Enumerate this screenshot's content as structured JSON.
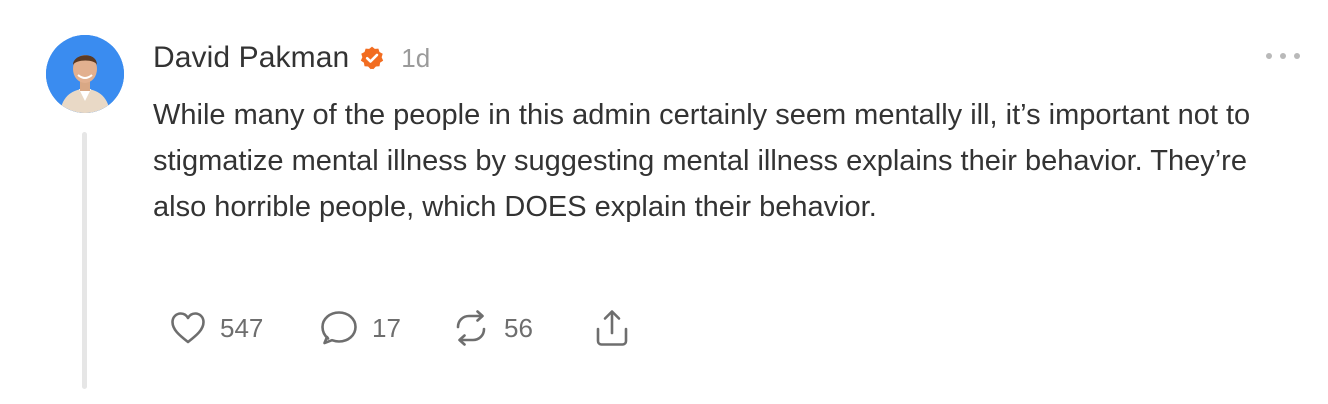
{
  "post": {
    "author": "David Pakman",
    "timestamp": "1d",
    "text": "While many of the people in this admin certainly seem mentally ill, it’s important not to stigmatize mental illness by suggesting mental illness explains their behavior. They’re also horrible people, which DOES explain their behavior.",
    "verified_badge_color": "#f26d21",
    "avatar_background": "#2a7de1"
  },
  "actions": {
    "like": {
      "icon": "heart-icon",
      "count": "547"
    },
    "reply": {
      "icon": "comment-icon",
      "count": "17"
    },
    "repost": {
      "icon": "repost-icon",
      "count": "56"
    },
    "share": {
      "icon": "share-icon"
    }
  },
  "menu": {
    "icon": "more-options-icon"
  }
}
